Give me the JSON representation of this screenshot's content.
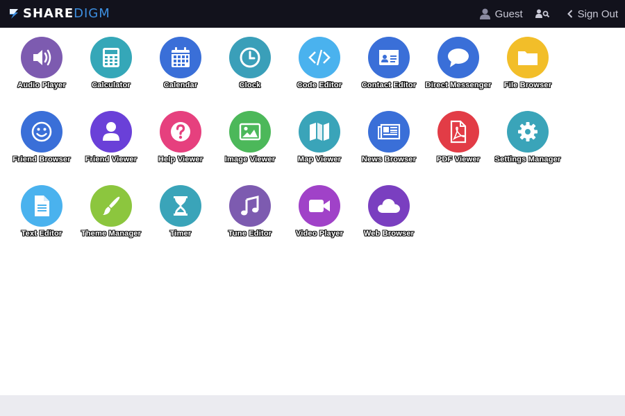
{
  "header": {
    "logo_part1": "SHARE",
    "logo_part2": "DIGM",
    "user_label": "Guest",
    "signout_label": "Sign Out",
    "colors": {
      "bar": "#12121c",
      "logo_accent": "#3d8fe0"
    }
  },
  "apps": [
    {
      "label": "Audio Player",
      "icon": "volume-icon",
      "color": "#7d5bb0"
    },
    {
      "label": "Calculator",
      "icon": "calculator-icon",
      "color": "#35a7b8"
    },
    {
      "label": "Calendar",
      "icon": "calendar-icon",
      "color": "#3a6fd8"
    },
    {
      "label": "Clock",
      "icon": "clock-icon",
      "color": "#3a9fb9"
    },
    {
      "label": "Code Editor",
      "icon": "code-icon",
      "color": "#4ab2ee"
    },
    {
      "label": "Contact Editor",
      "icon": "contact-card-icon",
      "color": "#3a6fd8"
    },
    {
      "label": "Direct Messenger",
      "icon": "speech-bubble-icon",
      "color": "#3a6fd8"
    },
    {
      "label": "File Browser",
      "icon": "folder-icon",
      "color": "#f2be29"
    },
    {
      "label": "Friend Browser",
      "icon": "smiley-icon",
      "color": "#3a6fd8"
    },
    {
      "label": "Friend Viewer",
      "icon": "user-icon",
      "color": "#6a40d8"
    },
    {
      "label": "Help Viewer",
      "icon": "question-icon",
      "color": "#e6407e"
    },
    {
      "label": "Image Viewer",
      "icon": "image-icon",
      "color": "#4cb85a"
    },
    {
      "label": "Map Viewer",
      "icon": "map-icon",
      "color": "#3aa4b9"
    },
    {
      "label": "News Browser",
      "icon": "newspaper-icon",
      "color": "#3a6fd8"
    },
    {
      "label": "PDF Viewer",
      "icon": "pdf-icon",
      "color": "#e23c46"
    },
    {
      "label": "Settings Manager",
      "icon": "gear-icon",
      "color": "#3aa4b9"
    },
    {
      "label": "Text Editor",
      "icon": "document-icon",
      "color": "#4ab2ee"
    },
    {
      "label": "Theme Manager",
      "icon": "paintbrush-icon",
      "color": "#8cc63e"
    },
    {
      "label": "Timer",
      "icon": "hourglass-icon",
      "color": "#3aa4b9"
    },
    {
      "label": "Tune Editor",
      "icon": "music-note-icon",
      "color": "#7d5bb0"
    },
    {
      "label": "Video Player",
      "icon": "video-camera-icon",
      "color": "#a042c8"
    },
    {
      "label": "Web Browser",
      "icon": "cloud-icon",
      "color": "#7a3fc0"
    }
  ]
}
